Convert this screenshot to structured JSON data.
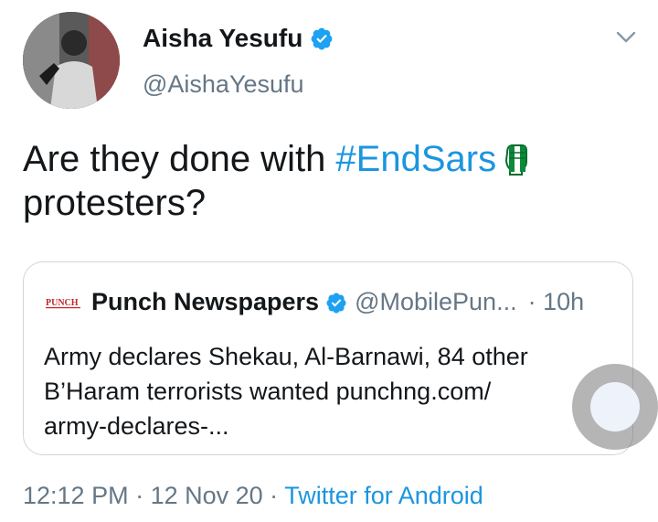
{
  "author": {
    "display_name": "Aisha Yesufu",
    "handle": "@AishaYesufu",
    "avatar_icon": "profile-photo",
    "verified_icon": "verified-badge-icon"
  },
  "tweet": {
    "text_before": "Are they done with ",
    "hashtag": "#EndSars",
    "text_after": "protesters?",
    "emoji_icon": "raised-fist-nigeria-icon"
  },
  "quoted_tweet": {
    "logo_text": "PUNCH",
    "display_name": "Punch Newspapers",
    "handle": "@MobilePun...",
    "time": "· 10h",
    "lines": [
      "Army declares Shekau, Al-Barnawi, 84 other",
      "B’Haram terrorists wanted punchng.com/",
      "army-declares-..."
    ]
  },
  "meta": {
    "time": "12:12 PM",
    "separator": " · ",
    "date": "12 Nov 20",
    "separator2": " · ",
    "source": "Twitter for Android"
  },
  "colors": {
    "link": "#1b95e0",
    "secondary_text": "#657786",
    "verified": "#1da1f2",
    "border": "#ccd6dd"
  }
}
